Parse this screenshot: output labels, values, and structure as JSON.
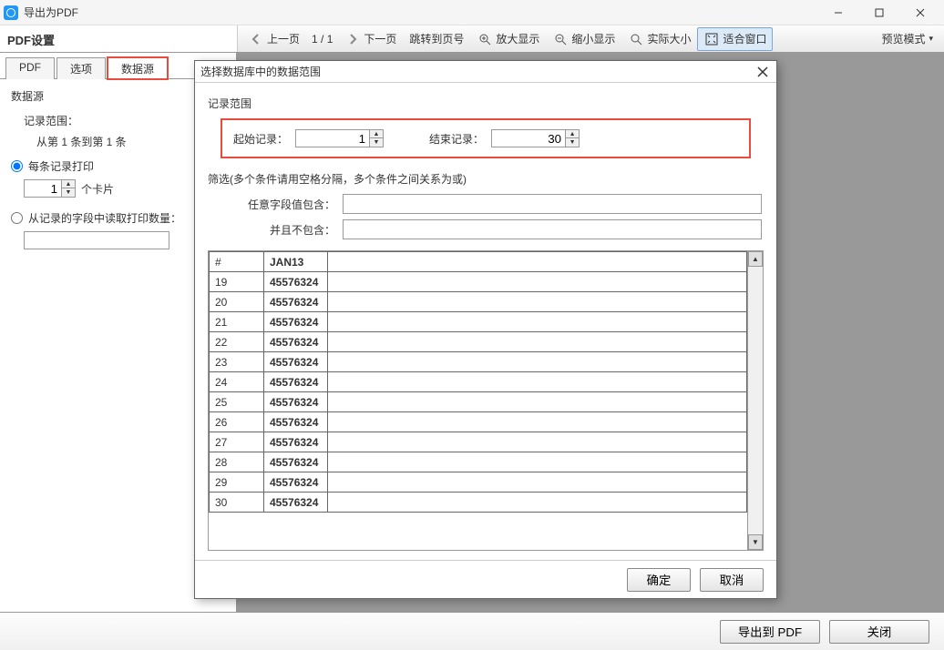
{
  "window": {
    "title": "导出为PDF"
  },
  "toprow": {
    "settings_title": "PDF设置",
    "prev": "上一页",
    "page_indicator": "1 / 1",
    "next": "下一页",
    "jump": "跳转到页号",
    "zoom_in": "放大显示",
    "zoom_out": "缩小显示",
    "actual": "实际大小",
    "fit": "适合窗口",
    "preview_mode": "预览模式",
    "dropdown_glyph": "▾"
  },
  "tabs": [
    "PDF",
    "选项",
    "数据源"
  ],
  "left": {
    "group": "数据源",
    "range_label": "记录范围：",
    "range_text": "从第 1 条到第 1 条",
    "print_each": "每条记录打印",
    "cards": "个卡片",
    "cards_value": "1",
    "read_count": "从记录的字段中读取打印数量："
  },
  "dialog": {
    "title": "选择数据库中的数据范围",
    "range_section": "记录范围",
    "start_label": "起始记录：",
    "start_value": "1",
    "end_label": "结束记录：",
    "end_value": "30",
    "filter_section": "筛选(多个条件请用空格分隔，多个条件之间关系为或)",
    "contains": "任意字段值包含：",
    "not_contains": "并且不包含：",
    "col_num": "#",
    "col_code": "JAN13",
    "rows": [
      {
        "n": "19",
        "v": "45576324"
      },
      {
        "n": "20",
        "v": "45576324"
      },
      {
        "n": "21",
        "v": "45576324"
      },
      {
        "n": "22",
        "v": "45576324"
      },
      {
        "n": "23",
        "v": "45576324"
      },
      {
        "n": "24",
        "v": "45576324"
      },
      {
        "n": "25",
        "v": "45576324"
      },
      {
        "n": "26",
        "v": "45576324"
      },
      {
        "n": "27",
        "v": "45576324"
      },
      {
        "n": "28",
        "v": "45576324"
      },
      {
        "n": "29",
        "v": "45576324"
      },
      {
        "n": "30",
        "v": "45576324"
      }
    ],
    "ok": "确定",
    "cancel": "取消"
  },
  "footer": {
    "export": "导出到 PDF",
    "close": "关闭"
  }
}
